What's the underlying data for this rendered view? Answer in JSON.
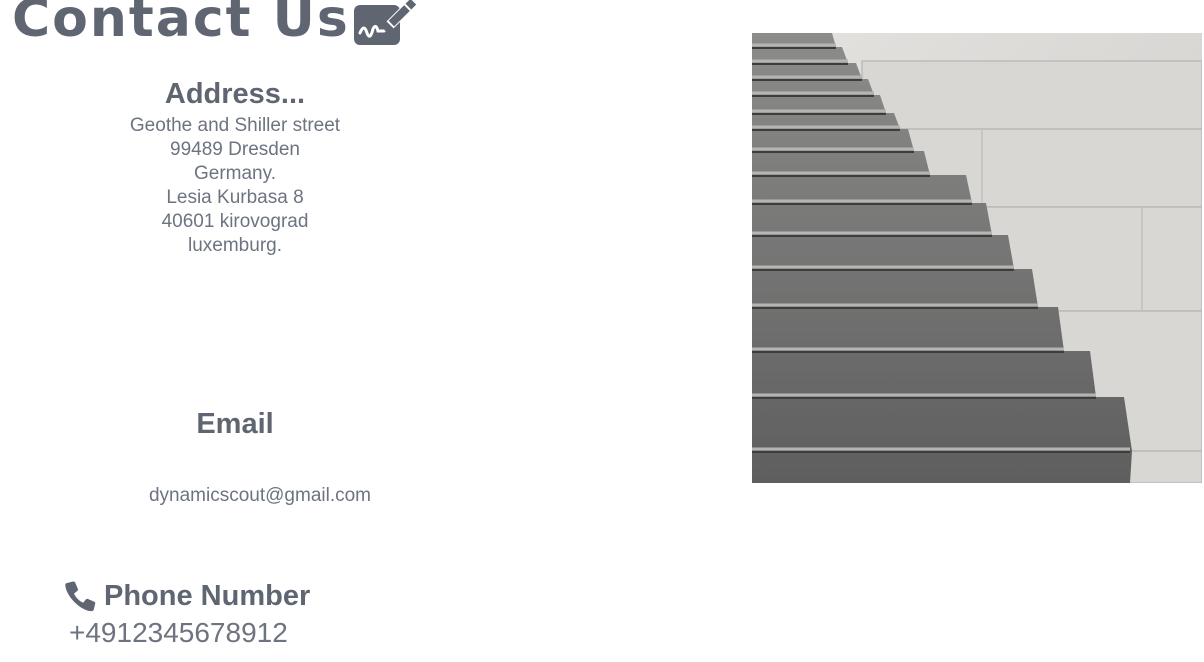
{
  "title": {
    "text": "Contact Us",
    "icon": "signature-edit-icon"
  },
  "address": {
    "heading": "Address...",
    "lines": [
      "Geothe and Shiller street",
      "99489 Dresden",
      "Germany.",
      "Lesia Kurbasa 8",
      "40601 kirovograd",
      "luxemburg."
    ]
  },
  "email": {
    "heading": "Email",
    "value": "dynamicscout@gmail.com"
  },
  "phone": {
    "icon": "phone-icon",
    "heading": "Phone Number",
    "value": "+4912345678912"
  },
  "image": {
    "subject": "concrete staircase photo"
  },
  "colors": {
    "text": "#5f6672",
    "body_text": "#6d7480",
    "background": "#ffffff"
  }
}
